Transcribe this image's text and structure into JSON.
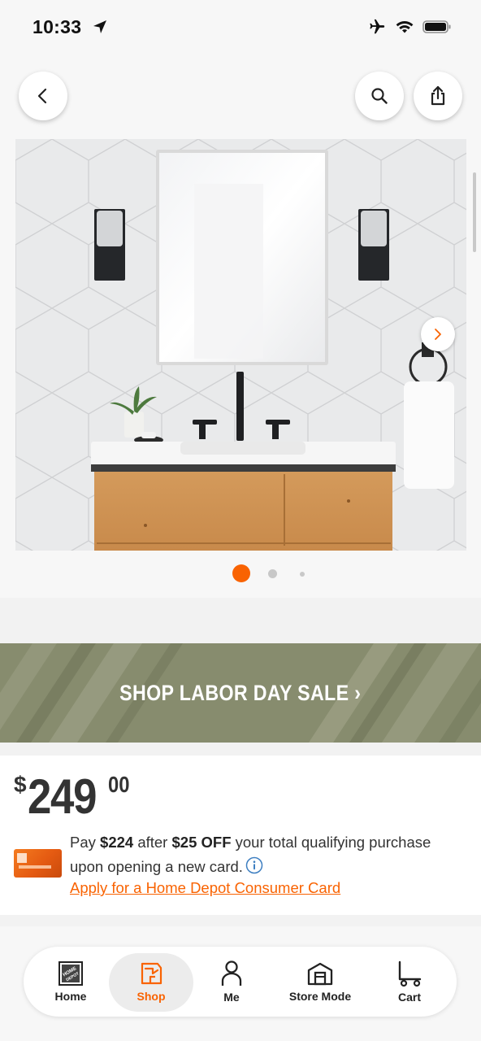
{
  "status_bar": {
    "time": "10:33",
    "icons": [
      "location-arrow-icon",
      "airplane-icon",
      "wifi-icon",
      "battery-icon"
    ]
  },
  "header": {
    "back_icon": "chevron-left-icon",
    "search_icon": "search-icon",
    "share_icon": "share-icon"
  },
  "carousel": {
    "slide_count": 3,
    "active_index": 0,
    "next_icon": "chevron-right-icon"
  },
  "sale_banner": {
    "text": "SHOP LABOR DAY SALE ›"
  },
  "price": {
    "dollar_sign": "$",
    "dollars": "249",
    "cents": "00"
  },
  "promo": {
    "p1": "Pay ",
    "discounted_price": "$224",
    "p2": " after ",
    "discount": "$25 OFF",
    "p3": " your total qualifying purchase upon opening a new card.",
    "apply_link": "Apply for a Home Depot Consumer Card",
    "info_icon": "info-icon"
  },
  "bottom_nav": {
    "items": [
      {
        "label": "Home",
        "icon": "home-depot-logo-icon"
      },
      {
        "label": "Shop",
        "icon": "shop-icon",
        "active": true
      },
      {
        "label": "Me",
        "icon": "person-icon"
      },
      {
        "label": "Store Mode",
        "icon": "store-icon"
      },
      {
        "label": "Cart",
        "icon": "cart-icon"
      }
    ]
  },
  "colors": {
    "brand_orange": "#f96302",
    "banner_olive": "#878c6e"
  }
}
